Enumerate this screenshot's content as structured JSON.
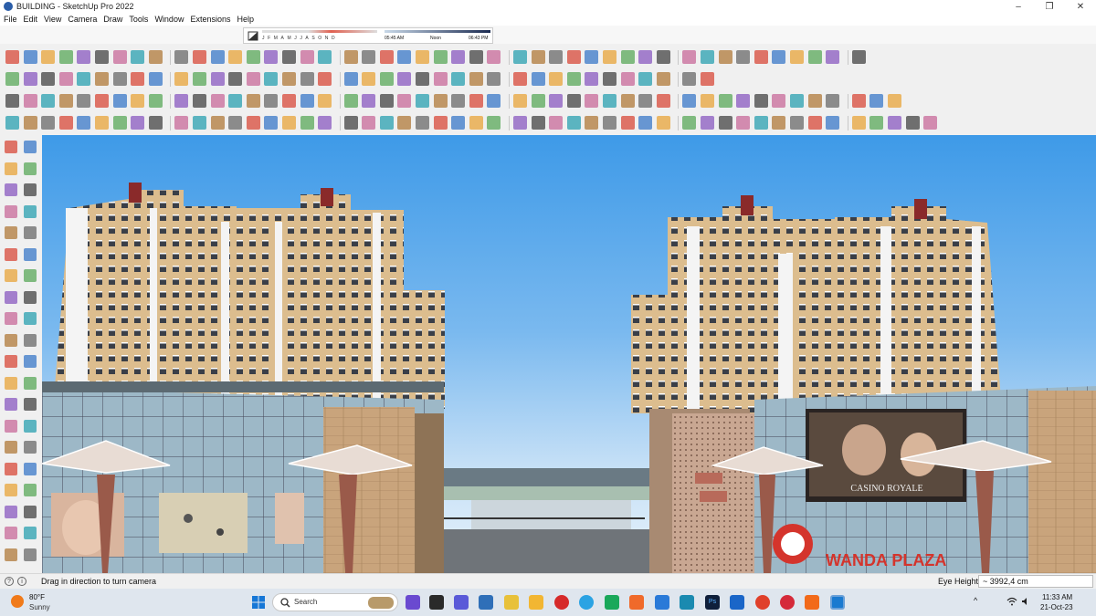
{
  "window": {
    "title": "BUILDING - SketchUp Pro 2022",
    "controls": {
      "minimize": "–",
      "maximize": "❐",
      "close": "✕"
    }
  },
  "menu": [
    "File",
    "Edit",
    "View",
    "Camera",
    "Draw",
    "Tools",
    "Window",
    "Extensions",
    "Help"
  ],
  "shadow": {
    "months": "JFMAMJJASOND",
    "time_start": "05:45 AM",
    "time_noon": "Noon",
    "time_end": "06:43 PM"
  },
  "toolbars": {
    "row1_count": 46,
    "row2_count": 38,
    "row3_count": 50,
    "row4_count": 58
  },
  "viewport": {
    "sign_text": "WANDA PLAZA",
    "billboard_text": "CASINO ROYALE"
  },
  "status": {
    "hint": "Drag in direction to turn camera",
    "measure_label": "Eye Height",
    "measure_value": "~ 3992,4 cm"
  },
  "taskbar": {
    "weather_temp": "80°F",
    "weather_desc": "Sunny",
    "search_text": "Search",
    "ps_label": "Ps",
    "clock_time": "11:33 AM",
    "clock_date": "21-Oct-23",
    "tray_chevron": "^"
  },
  "colors": {
    "sky_top": "#3e9ae8",
    "tower_facade": "#d9b98a",
    "glass": "#9fb9c8",
    "accent_red": "#d4342c",
    "taskbar": "#dfe6ee"
  }
}
